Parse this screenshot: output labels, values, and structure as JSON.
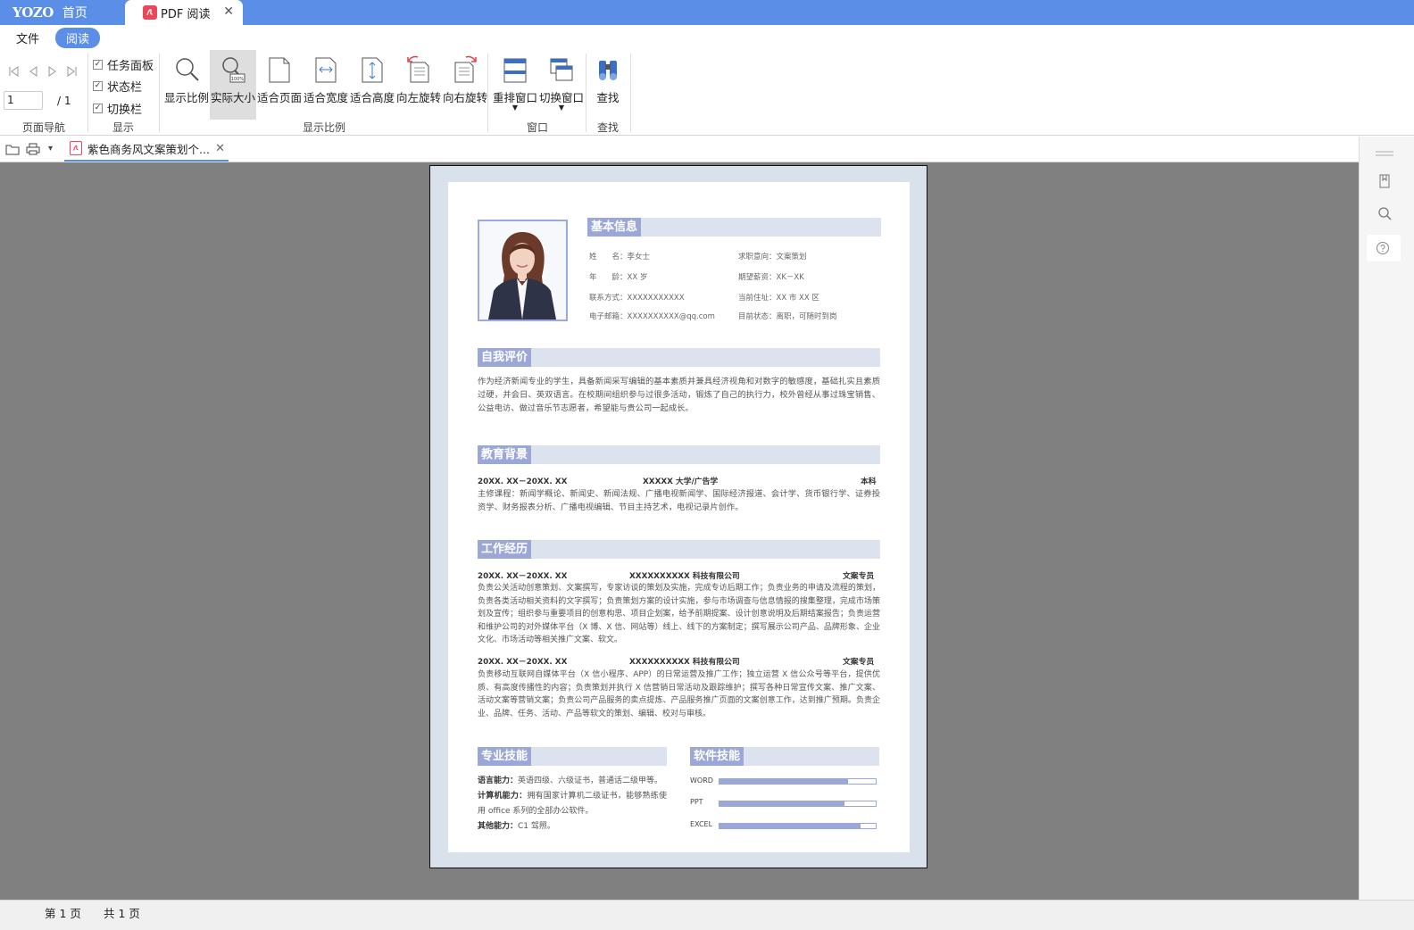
{
  "window": {
    "logo": "YOZO",
    "home_tab": "首页",
    "doc_tab": "PDF 阅读",
    "close_glyph": "✕"
  },
  "menu": {
    "file": "文件",
    "read": "阅读"
  },
  "ribbon": {
    "page_nav": {
      "current_page": "1",
      "total": "/ 1",
      "label": "页面导航"
    },
    "display": {
      "label": "显示",
      "options": [
        {
          "label": "任务面板",
          "checked": true
        },
        {
          "label": "状态栏",
          "checked": true
        },
        {
          "label": "切换栏",
          "checked": true
        }
      ]
    },
    "zoom": {
      "label": "显示比例",
      "tools": [
        "显示比例",
        "实际大小",
        "适合页面",
        "适合宽度",
        "适合高度",
        "向左旋转",
        "向右旋转"
      ],
      "selected": "实际大小"
    },
    "window_group": {
      "label": "窗口",
      "tools": [
        "重排窗口",
        "切换窗口"
      ]
    },
    "find_group": {
      "label": "查找",
      "tools": [
        "查找"
      ]
    }
  },
  "file_tab": {
    "name": "紫色商务风文案策划个...",
    "close_glyph": "✕"
  },
  "status": {
    "current": "第 1 页",
    "total": "共 1 页"
  },
  "resume": {
    "basic": {
      "title": "基本信息",
      "left": [
        "姓　　名：李女士",
        "年　　龄：XX 岁",
        "联系方式：XXXXXXXXXXX",
        "电子邮箱：XXXXXXXXXX@qq.com"
      ],
      "right": [
        "求职意向：文案策划",
        "期望薪资：XK－XK",
        "当前住址：XX 市 XX 区",
        "目前状态：离职，可随时到岗"
      ]
    },
    "self": {
      "title": "自我评价",
      "text": "作为经济新闻专业的学生，具备新闻采写编辑的基本素质并兼具经济视角和对数字的敏感度，基础扎实且素质过硬，并会日、英双语言。在校期间组织参与过很多活动，锻炼了自己的执行力，校外曾经从事过珠宝销售、公益电访、做过音乐节志愿者，希望能与贵公司一起成长。"
    },
    "edu": {
      "title": "教育背景",
      "date": "20XX. XX－20XX. XX",
      "school": "XXXXX 大学/广告学",
      "degree": "本科",
      "text": "主修课程：新闻学概论、新闻史、新闻法规、广播电视新闻学、国际经济报道、会计学、货币银行学、证券投资学、财务报表分析、广播电视编辑、节目主持艺术，电视记录片创作。"
    },
    "work": {
      "title": "工作经历",
      "jobs": [
        {
          "date": "20XX. XX－20XX. XX",
          "company": "XXXXXXXXXX 科技有限公司",
          "role": "文案专员",
          "text": "负责公关活动创意策划、文案撰写，专家访谈的策划及实施，完成专访后期工作；负责业务的申请及流程的策划，负责各类活动相关资料的文字撰写；负责策划方案的设计实施，参与市场调查与信息情报的搜集整理，完成市场策划及宣传；组织参与重要项目的创意构思、项目企划案，给予前期提案、设计创意说明及后期结案报告；负责运营和维护公司的对外媒体平台（X 博、X 信、网站等）线上、线下的方案制定；撰写展示公司产品、品牌形象、企业文化、市场活动等相关推广文案、软文。"
        },
        {
          "date": "20XX. XX－20XX. XX",
          "company": "XXXXXXXXXX 科技有限公司",
          "role": "文案专员",
          "text": "负责移动互联网自媒体平台（X 信小程序、APP）的日常运营及推广工作；独立运营 X 信公众号等平台，提供优质、有高度传播性的内容；负责策划并执行 X 信营销日常活动及跟踪维护；撰写各种日常宣传文案、推广文案、活动文案等营销文案；负责公司产品服务的卖点提炼、产品服务推广页面的文案创意工作，达到推广预期。负责企业、品牌、任务、活动、产品等软文的策划、编辑、校对与审核。"
        }
      ]
    },
    "skills": {
      "title": "专业技能",
      "items": [
        {
          "k": "语言能力：",
          "v": "英语四级、六级证书，普通话二级甲等。"
        },
        {
          "k": "计算机能力：",
          "v": "拥有国家计算机二级证书，能够熟练使用 office 系列的全部办公软件。"
        },
        {
          "k": "其他能力：",
          "v": "C1 驾照。"
        }
      ]
    },
    "software": {
      "title": "软件技能",
      "items": [
        {
          "name": "WORD",
          "level": 0.82
        },
        {
          "name": "PPT",
          "level": 0.8
        },
        {
          "name": "EXCEL",
          "level": 0.9
        }
      ]
    }
  },
  "colors": {
    "accent": "#5b8ee6",
    "section": "#9aa7d7",
    "section_bg": "#dde3ee",
    "workspace": "#808080"
  }
}
